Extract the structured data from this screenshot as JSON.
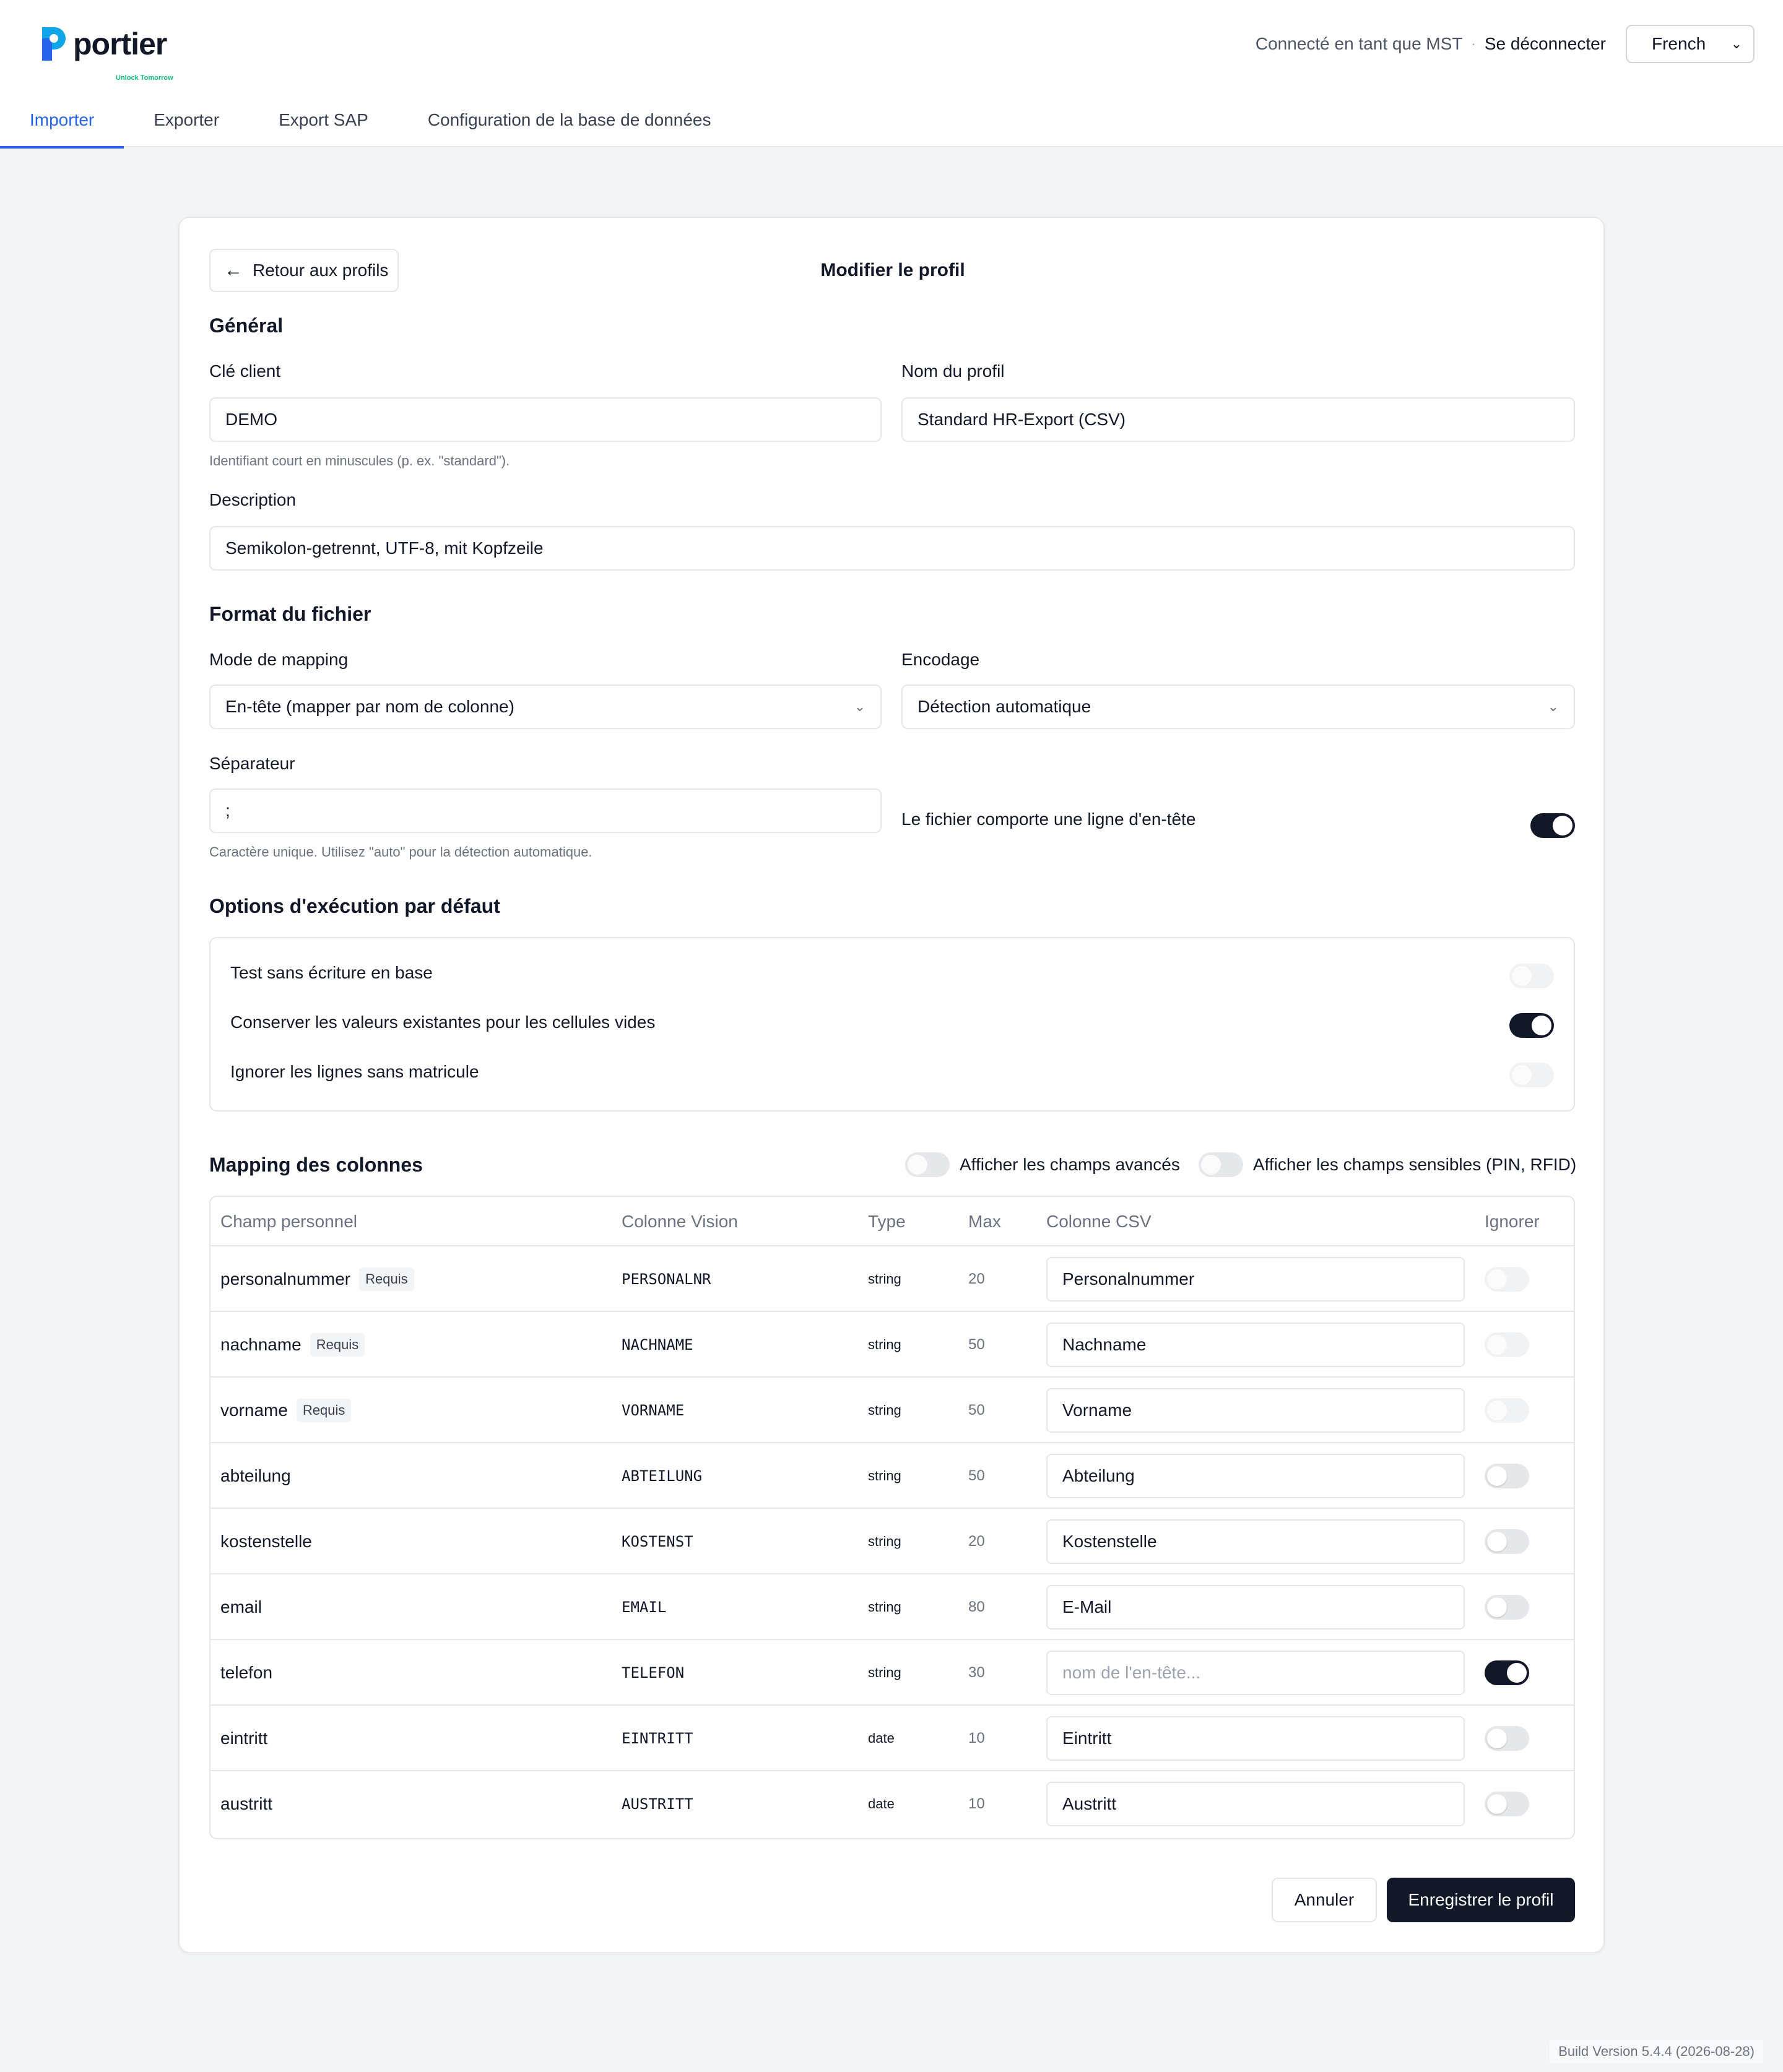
{
  "brand": {
    "name": "portier",
    "tagline": "Unlock Tomorrow",
    "accent": "#2563eb",
    "logo_color": "#0ea5e9"
  },
  "header": {
    "user_text": "Connecté en tant que MST",
    "logout": "Se déconnecter",
    "language": "French"
  },
  "tabs": [
    {
      "label": "Importer",
      "active": true
    },
    {
      "label": "Exporter"
    },
    {
      "label": "Export SAP"
    },
    {
      "label": "Configuration de la base de données"
    }
  ],
  "card": {
    "back_label": "Retour aux profils",
    "title": "Modifier le profil"
  },
  "general": {
    "title": "Général",
    "client_key_label": "Clé client",
    "client_key_value": "DEMO",
    "client_key_hint": "Identifiant court en minuscules (p. ex. \"standard\").",
    "profile_name_label": "Nom du profil",
    "profile_name_value": "Standard HR-Export (CSV)",
    "description_label": "Description",
    "description_value": "Semikolon-getrennt, UTF-8, mit Kopfzeile"
  },
  "file_format": {
    "title": "Format du fichier",
    "mapping_mode_label": "Mode de mapping",
    "mapping_mode_value": "En-tête (mapper par nom de colonne)",
    "encoding_label": "Encodage",
    "encoding_value": "Détection automatique",
    "separator_label": "Séparateur",
    "separator_value": ";",
    "separator_hint": "Caractère unique. Utilisez \"auto\" pour la détection automatique.",
    "header_row_label": "Le fichier comporte une ligne d'en-tête",
    "header_row_on": true
  },
  "run_options": {
    "title": "Options d'exécution par défaut",
    "items": [
      {
        "label": "Test sans écriture en base",
        "on": false
      },
      {
        "label": "Conserver les valeurs existantes pour les cellules vides",
        "on": true
      },
      {
        "label": "Ignorer les lignes sans matricule",
        "on": false
      }
    ]
  },
  "mapping": {
    "title": "Mapping des colonnes",
    "advanced_label": "Afficher les champs avancés",
    "sensitive_label": "Afficher les champs sensibles (PIN, RFID)",
    "columns": [
      "Champ personnel",
      "Colonne Vision",
      "Type",
      "Max",
      "Colonne CSV",
      "Ignorer"
    ],
    "required_badge": "Requis",
    "rows": [
      {
        "field": "personalnummer",
        "required": true,
        "vision": "PERSONALNR",
        "type": "string",
        "max": "20",
        "csv": "Personalnummer",
        "ignore": false,
        "locked": true
      },
      {
        "field": "nachname",
        "required": true,
        "vision": "NACHNAME",
        "type": "string",
        "max": "50",
        "csv": "Nachname",
        "ignore": false,
        "locked": true
      },
      {
        "field": "vorname",
        "required": true,
        "vision": "VORNAME",
        "type": "string",
        "max": "50",
        "csv": "Vorname",
        "ignore": false,
        "locked": true
      },
      {
        "field": "abteilung",
        "required": false,
        "vision": "ABTEILUNG",
        "type": "string",
        "max": "50",
        "csv": "Abteilung",
        "ignore": false
      },
      {
        "field": "kostenstelle",
        "required": false,
        "vision": "KOSTENST",
        "type": "string",
        "max": "20",
        "csv": "Kostenstelle",
        "ignore": false
      },
      {
        "field": "email",
        "required": false,
        "vision": "EMAIL",
        "type": "string",
        "max": "80",
        "csv": "E-Mail",
        "ignore": false
      },
      {
        "field": "telefon",
        "required": false,
        "vision": "TELEFON",
        "type": "string",
        "max": "30",
        "csv": "",
        "placeholder": "nom de l'en-tête...",
        "ignore": true
      },
      {
        "field": "eintritt",
        "required": false,
        "vision": "EINTRITT",
        "type": "date",
        "max": "10",
        "csv": "Eintritt",
        "ignore": false
      },
      {
        "field": "austritt",
        "required": false,
        "vision": "AUSTRITT",
        "type": "date",
        "max": "10",
        "csv": "Austritt",
        "ignore": false
      }
    ]
  },
  "actions": {
    "cancel": "Annuler",
    "save": "Enregistrer le profil"
  },
  "build": "Build Version 5.4.4 (2026-08-28)"
}
